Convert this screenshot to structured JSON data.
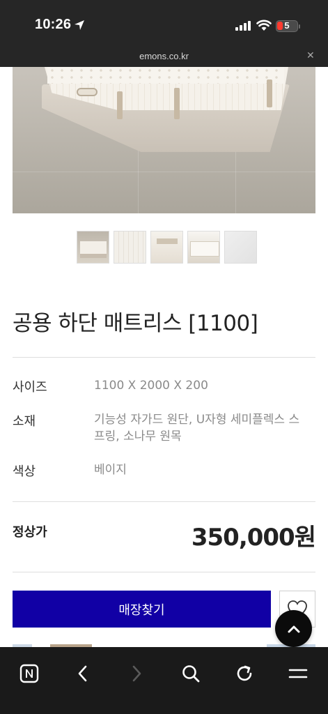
{
  "status_bar": {
    "time": "10:26",
    "battery_level": "5",
    "url": "emons.co.kr",
    "icons": [
      "location-arrow-icon",
      "cellular-signal-icon",
      "wifi-icon",
      "battery-icon"
    ]
  },
  "gallery": {
    "main_image": "mattress-on-base-photo",
    "thumbnails": [
      "thumb-mattress-bed",
      "thumb-fabric-closeup",
      "thumb-handle-detail",
      "thumb-mattress-side",
      "thumb-fabric-gray"
    ]
  },
  "product": {
    "title": "공용 하단 매트리스 [1100]",
    "specs": [
      {
        "label": "사이즈",
        "value": "1100 X 2000 X 200"
      },
      {
        "label": "소재",
        "value": "기능성 자가드 원단, U자형 세미플렉스 스프링, 소나무 원목"
      },
      {
        "label": "색상",
        "value": "베이지"
      }
    ],
    "price_label": "정상가",
    "price": "350,000원"
  },
  "actions": {
    "find_store_label": "매장찾기",
    "wishlist_icon": "heart-icon",
    "scroll_top_icon": "chevron-up-icon"
  },
  "browser_toolbar": {
    "buttons": [
      "naver-home-icon",
      "back-icon",
      "forward-icon",
      "search-icon",
      "reload-icon",
      "menu-icon"
    ]
  },
  "colors": {
    "primary_button": "#1100a5",
    "status_bar_bg": "#262626",
    "toolbar_bg": "#1a1a1a",
    "battery_low": "#ff3b30"
  }
}
